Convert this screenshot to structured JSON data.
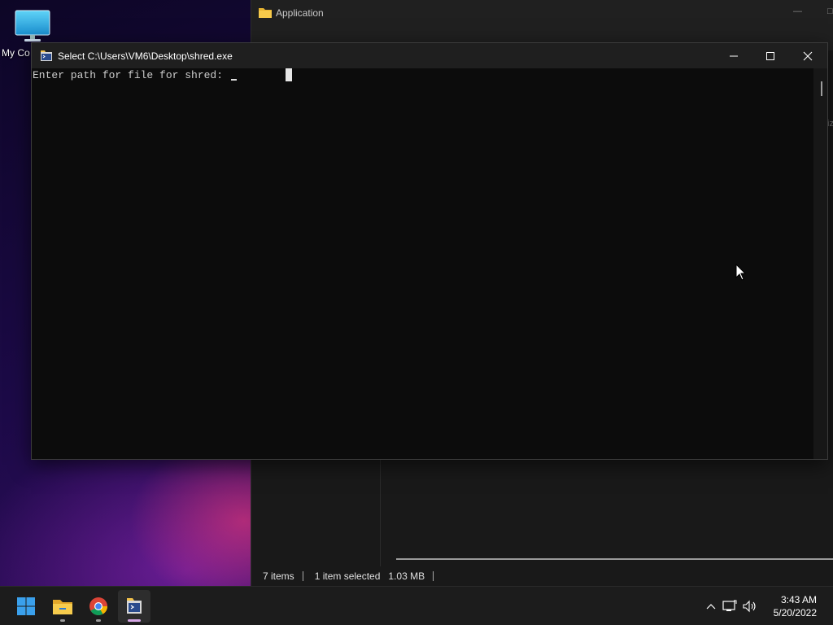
{
  "desktop": {
    "icons": [
      {
        "label": "My Co",
        "icon": "monitor-icon"
      }
    ]
  },
  "explorer": {
    "title": "Application",
    "title_icon": "folder-icon",
    "status": {
      "items_count": "7 items",
      "selection": "1 item selected",
      "size": "1.03 MB"
    },
    "right_partial_text": "iz"
  },
  "console": {
    "title": "Select C:\\Users\\VM6\\Desktop\\shred.exe",
    "prompt": "Enter path for file for shred: ",
    "buttons": {
      "minimize": "minimize-icon",
      "maximize": "maximize-icon",
      "close": "close-icon"
    }
  },
  "taskbar": {
    "apps": [
      {
        "name": "start",
        "icon": "windows-start-icon"
      },
      {
        "name": "file-explorer",
        "icon": "folder-icon"
      },
      {
        "name": "chrome",
        "icon": "chrome-icon"
      },
      {
        "name": "shred-console",
        "icon": "console-app-icon"
      }
    ],
    "tray": {
      "time": "3:43 AM",
      "date": "5/20/2022"
    }
  },
  "colors": {
    "console_bg": "#0c0c0c",
    "titlebar_bg": "#1f1f1f",
    "taskbar_bg": "#1c1c1c",
    "active_indicator": "#d6a7e6"
  }
}
